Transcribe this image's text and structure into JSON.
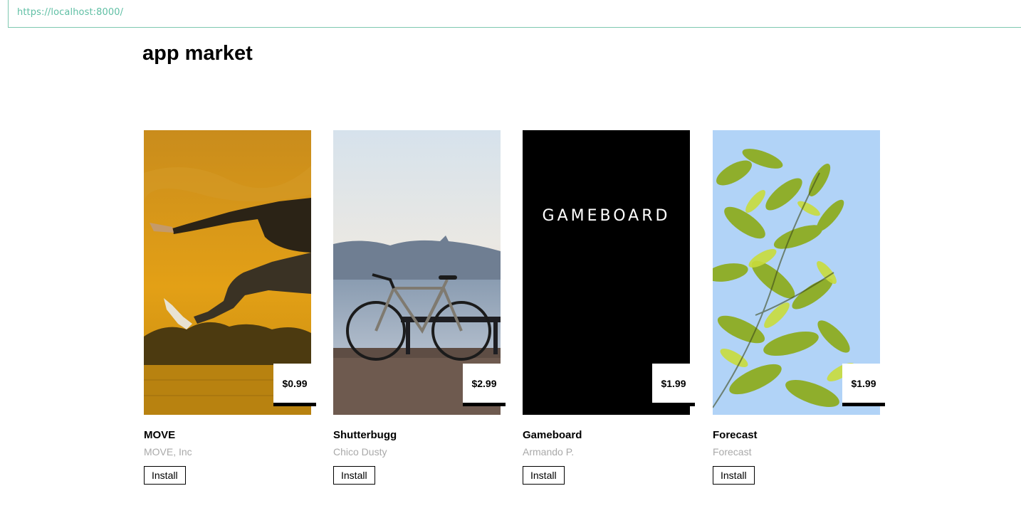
{
  "browser": {
    "url": "https://localhost:8000/"
  },
  "page": {
    "title": "app market"
  },
  "apps": [
    {
      "name": "MOVE",
      "developer": "MOVE, Inc",
      "price": "$0.99",
      "install_label": "Install",
      "image": "jumping-person-photo"
    },
    {
      "name": "Shutterbugg",
      "developer": "Chico Dusty",
      "price": "$2.99",
      "install_label": "Install",
      "image": "bicycle-lake-photo"
    },
    {
      "name": "Gameboard",
      "developer": "Armando P.",
      "price": "$1.99",
      "install_label": "Install",
      "image": "gameboard-logo",
      "logo_text": "GAMEBOARD"
    },
    {
      "name": "Forecast",
      "developer": "Forecast",
      "price": "$1.99",
      "install_label": "Install",
      "image": "leaves-sky-photo"
    }
  ],
  "colors": {
    "url_text": "#5fbfa4",
    "developer_text": "#a9a9a9",
    "move_bg": "#d8950f",
    "gameboard_bg": "#000000",
    "forecast_sky": "#b1d3f7"
  }
}
